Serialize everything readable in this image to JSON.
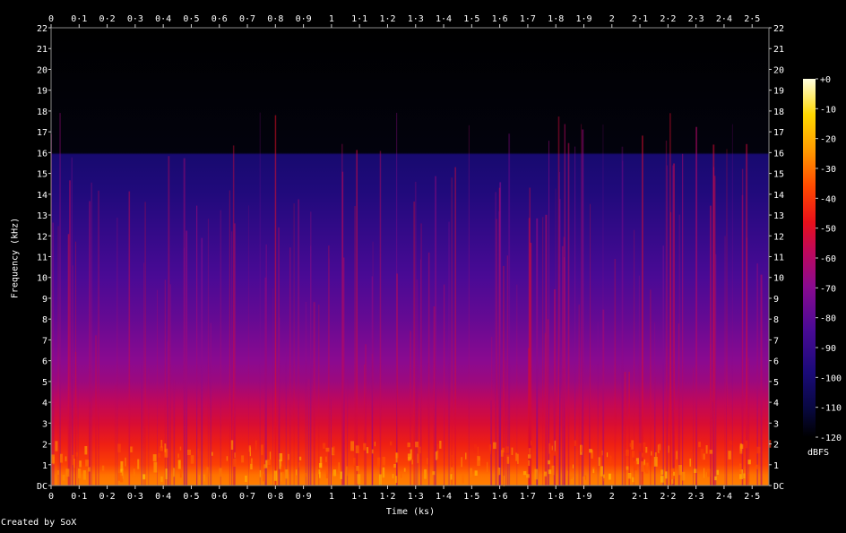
{
  "chart_data": {
    "type": "heatmap",
    "title": "",
    "xlabel": "Time (ks)",
    "ylabel": "Frequency (kHz)",
    "x_range": [
      0,
      2.56
    ],
    "y_range": [
      0,
      22
    ],
    "x_ticks": [
      "0",
      "0·1",
      "0·2",
      "0·3",
      "0·4",
      "0·5",
      "0·6",
      "0·7",
      "0·8",
      "0·9",
      "1",
      "1·1",
      "1·2",
      "1·3",
      "1·4",
      "1·5",
      "1·6",
      "1·7",
      "1·8",
      "1·9",
      "2",
      "2·1",
      "2·2",
      "2·3",
      "2·4",
      "2·5"
    ],
    "y_ticks": [
      "DC",
      "1",
      "2",
      "3",
      "4",
      "5",
      "6",
      "7",
      "8",
      "9",
      "10",
      "11",
      "12",
      "13",
      "14",
      "15",
      "16",
      "17",
      "18",
      "19",
      "20",
      "21",
      "22"
    ],
    "colorbar": {
      "unit": "dBFS",
      "ticks": [
        "+0",
        "-10",
        "-20",
        "-30",
        "-40",
        "-50",
        "-60",
        "-70",
        "-80",
        "-90",
        "-100",
        "-110",
        "-120"
      ],
      "range": [
        -120,
        0
      ]
    },
    "spectral_profile": {
      "frequency_khz": [
        0,
        0.5,
        1,
        2,
        3,
        4,
        5,
        6,
        8,
        10,
        12,
        14,
        15.9,
        16,
        22
      ],
      "level_dbfs": [
        -28,
        -30,
        -38,
        -45,
        -52,
        -58,
        -66,
        -70,
        -78,
        -84,
        -90,
        -96,
        -100,
        -118,
        -120
      ]
    },
    "grid": false
  },
  "credit": "Created by SoX"
}
